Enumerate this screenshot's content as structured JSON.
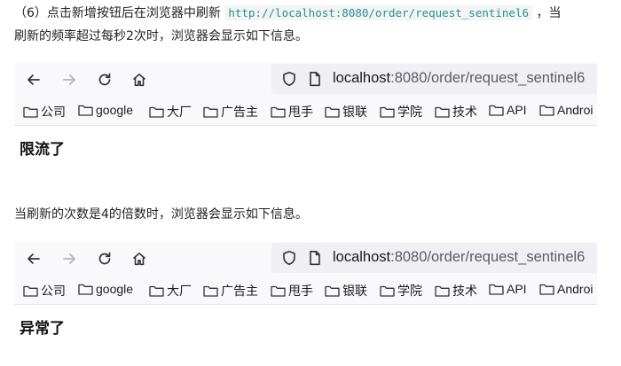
{
  "paragraph1": {
    "prefix": "（6）点击新增按钮后在浏览器中刷新",
    "code": "http://localhost:8080/order/request_sentinel6",
    "suffix": "，当",
    "line2": "刷新的频率超过每秒2次时，浏览器会显示如下信息。"
  },
  "paragraph2": "当刷新的次数是4的倍数时，浏览器会显示如下信息。",
  "browser": {
    "url_host": "localhost",
    "url_rest": ":8080/order/request_sentinel6",
    "bookmarks": [
      "公司",
      "google",
      "大厂",
      "广告主",
      "甩手",
      "银联",
      "学院",
      "技术",
      "API",
      "Androi"
    ]
  },
  "result1": "限流了",
  "result2": "异常了"
}
